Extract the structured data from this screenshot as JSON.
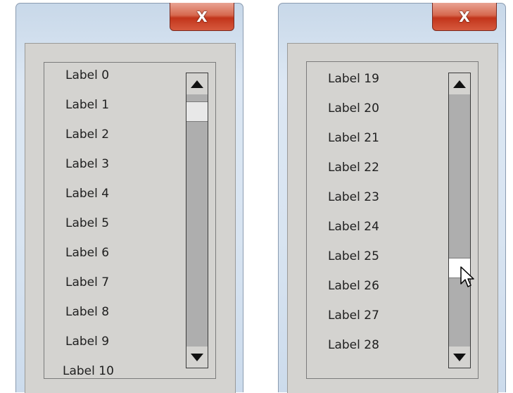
{
  "windows": [
    {
      "close_label": "X",
      "items": [
        "Label 0",
        "Label 1",
        "Label 2",
        "Label 3",
        "Label 4",
        "Label 5",
        "Label 6",
        "Label 7",
        "Label 8",
        "Label 9",
        "Label 10"
      ]
    },
    {
      "close_label": "X",
      "items": [
        "Label 19",
        "Label 20",
        "Label 21",
        "Label 22",
        "Label 23",
        "Label 24",
        "Label 25",
        "Label 26",
        "Label 27",
        "Label 28"
      ]
    }
  ]
}
